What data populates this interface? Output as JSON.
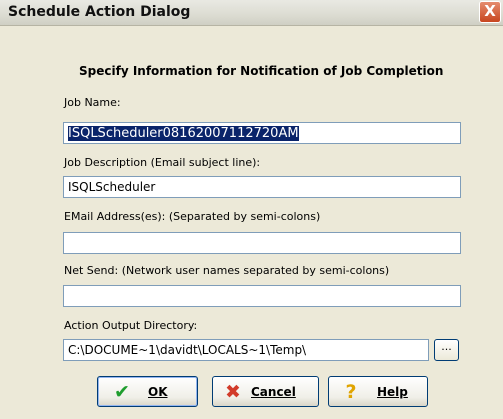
{
  "window": {
    "title": "Schedule Action Dialog",
    "close_label": "X"
  },
  "heading": "Specify Information for Notification of Job Completion",
  "fields": {
    "job_name": {
      "label": "Job Name:",
      "value": "ISQLScheduler08162007112720AM"
    },
    "job_description": {
      "label": "Job Description (Email subject line):",
      "value": "ISQLScheduler"
    },
    "email": {
      "label": "EMail Address(es): (Separated by semi-colons)",
      "value": ""
    },
    "net_send": {
      "label": "Net Send: (Network user names separated by semi-colons)",
      "value": ""
    },
    "output_dir": {
      "label": "Action Output Directory:",
      "value": "C:\\DOCUME~1\\davidt\\LOCALS~1\\Temp\\"
    }
  },
  "browse_label": "...",
  "buttons": {
    "ok": {
      "label": "OK",
      "icon": "checkmark-icon",
      "icon_glyph": "✔",
      "color": "#1f9d2e"
    },
    "cancel": {
      "label": "Cancel",
      "icon": "x-cross-icon",
      "icon_glyph": "✖",
      "color": "#d23b2a"
    },
    "help": {
      "label": "Help",
      "icon": "question-mark-icon",
      "icon_glyph": "?",
      "color": "#e0a400"
    }
  }
}
